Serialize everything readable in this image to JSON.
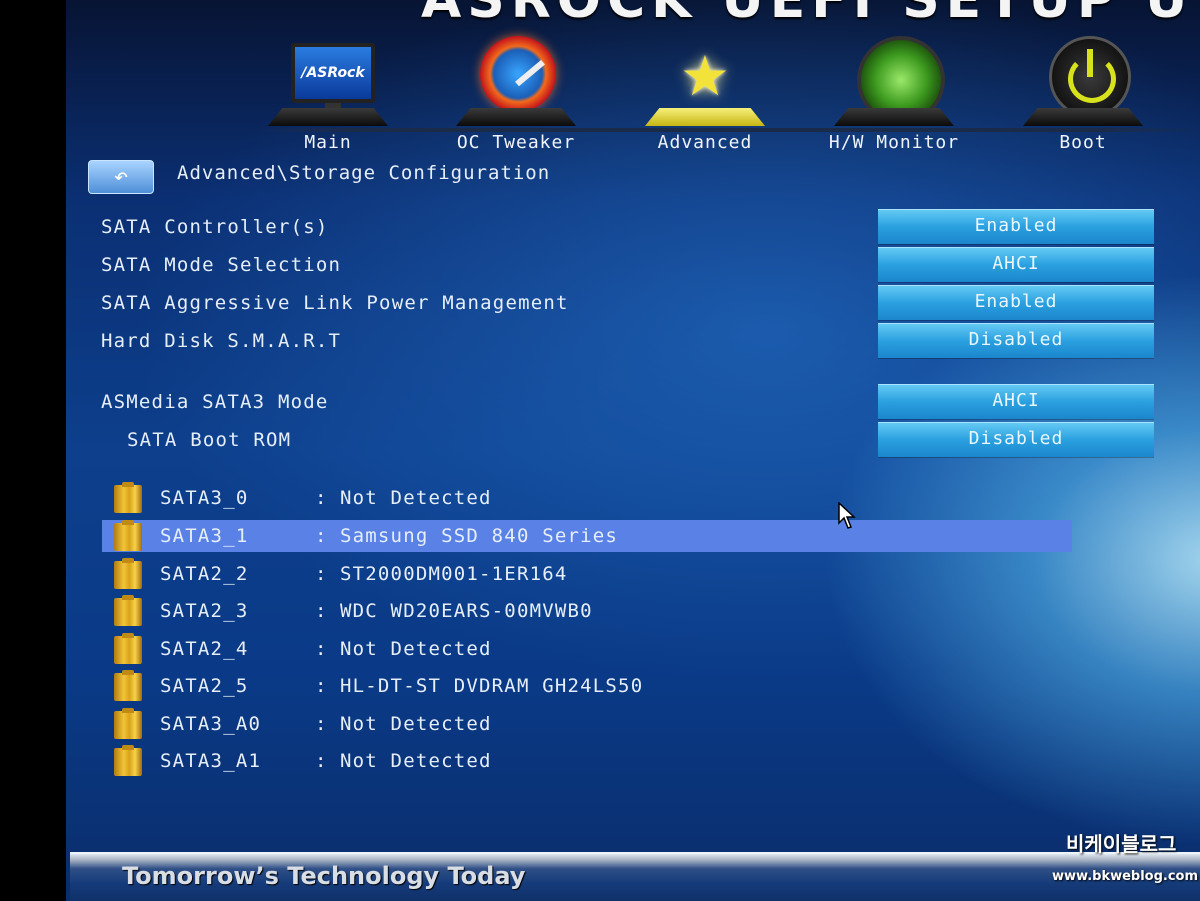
{
  "app_title": "ASROCK UEFI SETUP UT",
  "tabs": [
    {
      "label": "Main",
      "icon": "asrock-monitor-icon"
    },
    {
      "label": "OC Tweaker",
      "icon": "speedometer-icon"
    },
    {
      "label": "Advanced",
      "icon": "star-icon",
      "active": true
    },
    {
      "label": "H/W Monitor",
      "icon": "radar-icon"
    },
    {
      "label": "Boot",
      "icon": "power-icon"
    }
  ],
  "monitor_logo_text": "/ASRock",
  "back_button": {
    "icon": "back-arrow-icon",
    "glyph": "↶"
  },
  "breadcrumb": "Advanced\\Storage Configuration",
  "settings": [
    {
      "label": "SATA Controller(s)",
      "value": "Enabled"
    },
    {
      "label": "SATA Mode Selection",
      "value": "AHCI"
    },
    {
      "label": "SATA Aggressive Link Power Management",
      "value": "Enabled"
    },
    {
      "label": "Hard Disk S.M.A.R.T",
      "value": "Disabled"
    },
    {
      "label": "ASMedia SATA3 Mode",
      "value": "AHCI"
    },
    {
      "label": "SATA Boot ROM",
      "value": "Disabled"
    }
  ],
  "disks": [
    {
      "port": "SATA3_0",
      "device": "Not Detected"
    },
    {
      "port": "SATA3_1",
      "device": "Samsung SSD 840 Series",
      "selected": true
    },
    {
      "port": "SATA2_2",
      "device": "ST2000DM001-1ER164"
    },
    {
      "port": "SATA2_3",
      "device": "WDC WD20EARS-00MVWB0"
    },
    {
      "port": "SATA2_4",
      "device": "Not Detected"
    },
    {
      "port": "SATA2_5",
      "device": "HL-DT-ST DVDRAM GH24LS50"
    },
    {
      "port": "SATA3_A0",
      "device": "Not Detected"
    },
    {
      "port": "SATA3_A1",
      "device": "Not Detected"
    }
  ],
  "separator": ":",
  "footer": {
    "tagline": "Tomorrow’s Technology Today"
  },
  "watermark": {
    "name": "비케이블로그",
    "url": "www.bkweblog.com"
  },
  "colors": {
    "value_button": "#2aa0e0",
    "selected_row": "#5a82e6",
    "background": "#0d3f8c"
  }
}
